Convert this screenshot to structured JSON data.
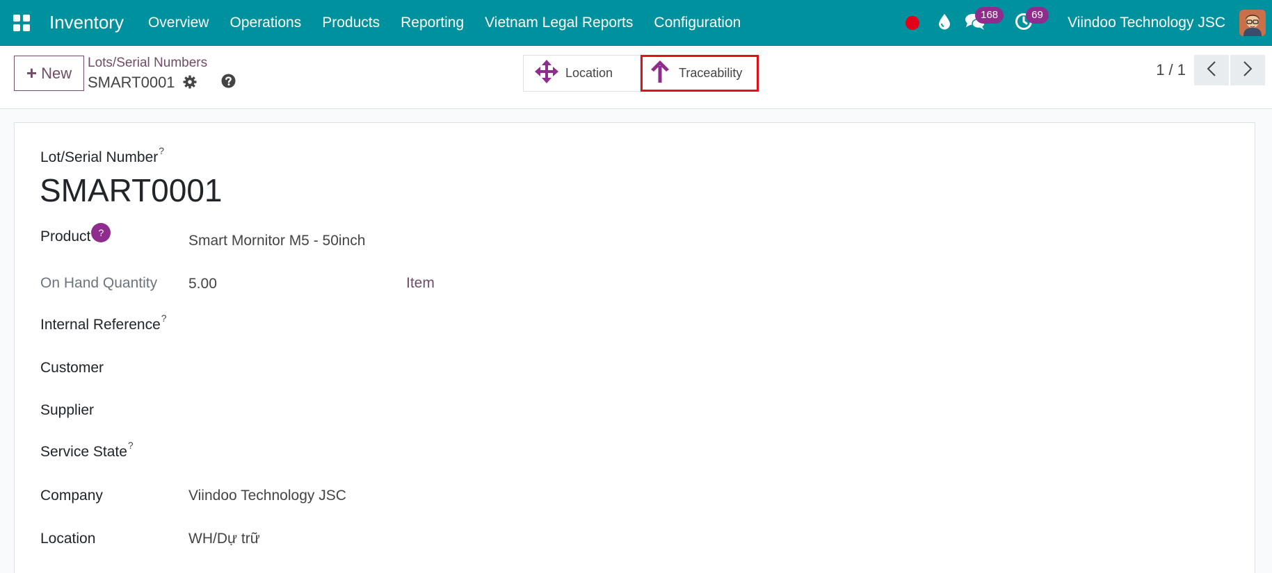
{
  "navbar": {
    "app_name": "Inventory",
    "menu": [
      "Overview",
      "Operations",
      "Products",
      "Reporting",
      "Vietnam Legal Reports",
      "Configuration"
    ],
    "messages_count": "168",
    "activities_count": "69",
    "company": "Viindoo Technology JSC",
    "color": "#00919e"
  },
  "control_panel": {
    "new_label": "New",
    "breadcrumb_parent": "Lots/Serial Numbers",
    "breadcrumb_current": "SMART0001",
    "smart_buttons": {
      "location_label": "Location",
      "traceability_label": "Traceability"
    },
    "pager": "1 / 1",
    "accent_color": "#714b67"
  },
  "form": {
    "lot_label": "Lot/Serial Number",
    "lot_name": "SMART0001",
    "fields": {
      "product": {
        "label": "Product",
        "value": "Smart Mornitor M5 - 50inch"
      },
      "on_hand": {
        "label": "On Hand Quantity",
        "value": "5.00",
        "uom": "Item"
      },
      "internal_reference": {
        "label": "Internal Reference",
        "value": ""
      },
      "customer": {
        "label": "Customer",
        "value": ""
      },
      "supplier": {
        "label": "Supplier",
        "value": ""
      },
      "service_state": {
        "label": "Service State",
        "value": ""
      },
      "company": {
        "label": "Company",
        "value": "Viindoo Technology JSC"
      },
      "location": {
        "label": "Location",
        "value": "WH/Dự trữ"
      }
    }
  }
}
